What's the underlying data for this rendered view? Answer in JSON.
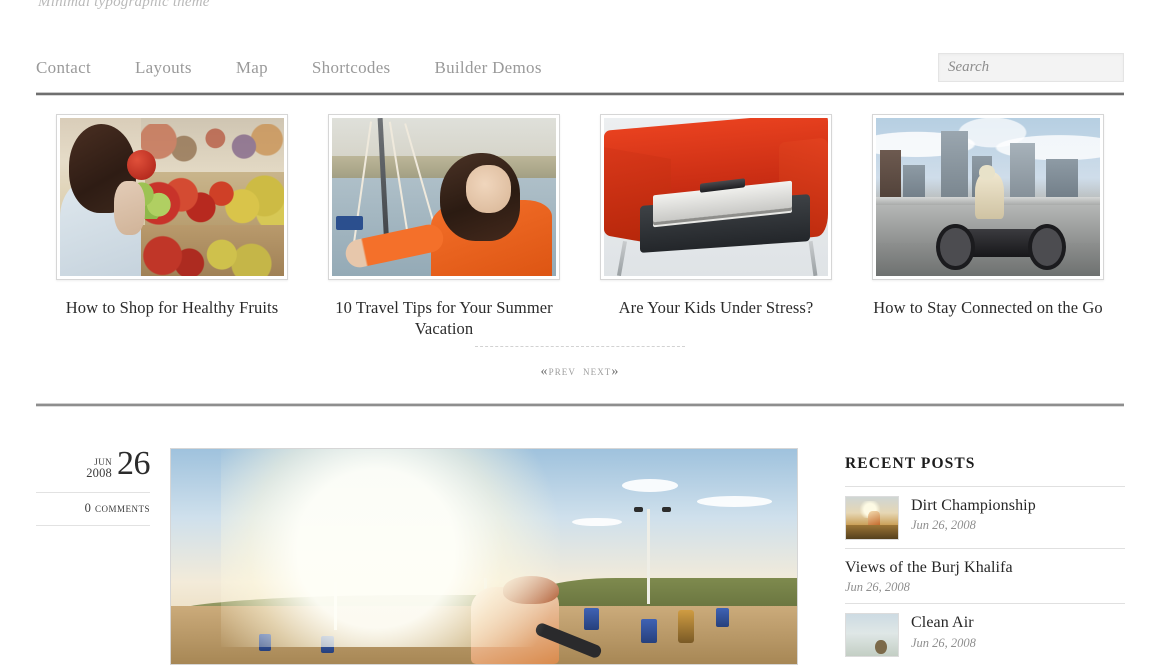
{
  "site": {
    "tagline": "Minimal typographic theme"
  },
  "nav": {
    "items": [
      {
        "label": "Contact",
        "name": "contact"
      },
      {
        "label": "Layouts",
        "name": "layouts"
      },
      {
        "label": "Map",
        "name": "map"
      },
      {
        "label": "Shortcodes",
        "name": "shortcodes"
      },
      {
        "label": "Builder Demos",
        "name": "builder-demos"
      }
    ]
  },
  "search": {
    "placeholder": "Search",
    "value": ""
  },
  "featured": {
    "items": [
      {
        "caption": "How to Shop for Healthy Fruits",
        "image": "woman-shopping-fruit-photo"
      },
      {
        "caption": "10 Travel Tips for Your Summer Vacation",
        "image": "woman-on-sailboat-photo"
      },
      {
        "caption": "Are Your Kids Under Stress?",
        "image": "red-chair-with-laptop-photo"
      },
      {
        "caption": "How to Stay Connected on the Go",
        "image": "motorcycle-city-skyline-photo"
      }
    ]
  },
  "pager": {
    "prev_chevron": "«",
    "prev_label": "Prev",
    "next_label": "Next",
    "next_chevron": "»"
  },
  "post": {
    "date": {
      "month": "Jun",
      "year": "2008",
      "day": "26"
    },
    "comments": "0 Comments",
    "image": "motocross-rider-sunset-photo"
  },
  "sidebar": {
    "widget_title": "Recent Posts",
    "recent_posts": [
      {
        "title": "Dirt Championship",
        "date": "Jun 26, 2008",
        "thumb": "dirt-championship-thumb"
      },
      {
        "title": "Views of the Burj Khalifa",
        "date": "Jun 26, 2008",
        "thumb": null
      },
      {
        "title": "Clean Air",
        "date": "Jun 26, 2008",
        "thumb": "clean-air-thumb"
      }
    ]
  },
  "colors": {
    "text_dark": "#2b2b2b",
    "text_muted": "#9a9a9a",
    "rule_dark": "#6f6f6f",
    "rule_gray": "#8e8e8e",
    "background": "#ffffff"
  }
}
